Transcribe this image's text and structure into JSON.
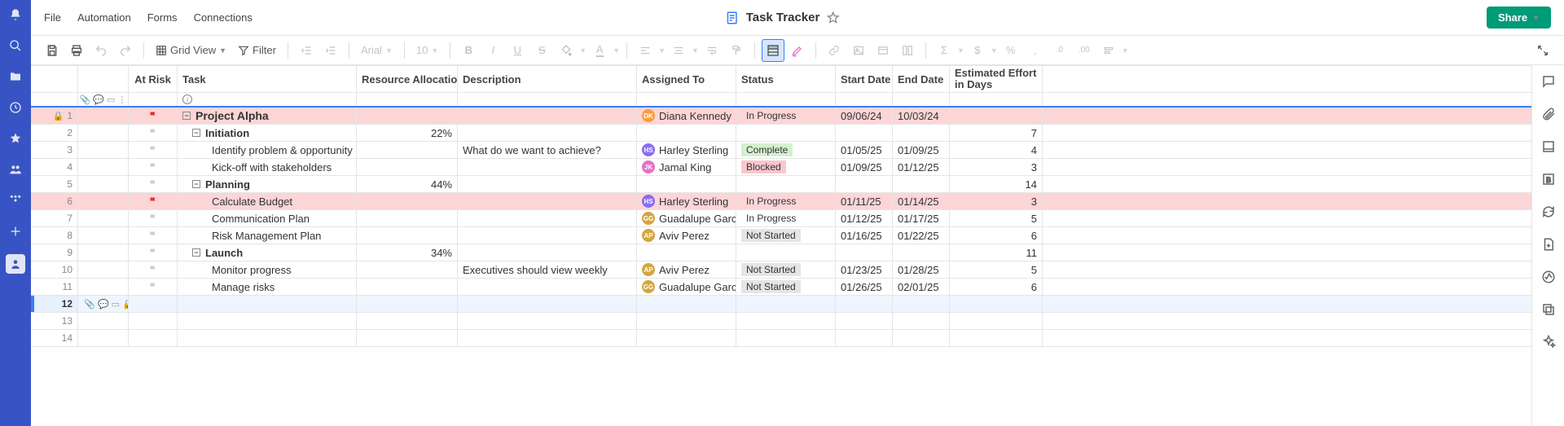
{
  "header": {
    "menu": {
      "file": "File",
      "automation": "Automation",
      "forms": "Forms",
      "connections": "Connections"
    },
    "title": "Task Tracker",
    "share": "Share"
  },
  "toolbar": {
    "view_label": "Grid View",
    "filter_label": "Filter",
    "font_label": "Arial",
    "size_label": "10"
  },
  "columns": {
    "atrisk": "At Risk",
    "task": "Task",
    "resource": "Resource Allocation",
    "description": "Description",
    "assigned": "Assigned To",
    "status": "Status",
    "start": "Start Date",
    "end": "End Date",
    "effort": "Estimated Effort in Days"
  },
  "rows": [
    {
      "n": 1,
      "lock": true,
      "flag": "red",
      "indent": 0,
      "toggle": true,
      "task": "Project Alpha",
      "resource": "",
      "desc": "",
      "assignee": {
        "name": "Diana Kennedy",
        "initials": "DK",
        "cls": "av-dk"
      },
      "status": "In Progress",
      "statusCls": "st-inprogress",
      "start": "09/06/24",
      "end": "10/03/24",
      "effort": "",
      "rowCls": "row-pink"
    },
    {
      "n": 2,
      "flag": "grey",
      "indent": 1,
      "toggle": true,
      "task": "Initiation",
      "resource": "22%",
      "desc": "",
      "assignee": null,
      "status": "",
      "start": "",
      "end": "",
      "effort": "7",
      "rowCls": ""
    },
    {
      "n": 3,
      "flag": "grey",
      "indent": 2,
      "task": "Identify problem & opportunity",
      "resource": "",
      "desc": "What do we want to achieve?",
      "assignee": {
        "name": "Harley Sterling",
        "initials": "HS",
        "cls": "av-hs"
      },
      "status": "Complete",
      "statusCls": "st-complete",
      "start": "01/05/25",
      "end": "01/09/25",
      "effort": "4",
      "rowCls": ""
    },
    {
      "n": 4,
      "flag": "grey",
      "indent": 2,
      "task": "Kick-off with stakeholders",
      "resource": "",
      "desc": "",
      "assignee": {
        "name": "Jamal King",
        "initials": "JK",
        "cls": "av-jk"
      },
      "status": "Blocked",
      "statusCls": "st-blocked",
      "start": "01/09/25",
      "end": "01/12/25",
      "effort": "3",
      "rowCls": ""
    },
    {
      "n": 5,
      "flag": "grey",
      "indent": 1,
      "toggle": true,
      "task": "Planning",
      "resource": "44%",
      "desc": "",
      "assignee": null,
      "status": "",
      "start": "",
      "end": "",
      "effort": "14",
      "rowCls": ""
    },
    {
      "n": 6,
      "flag": "red",
      "indent": 2,
      "task": "Calculate Budget",
      "resource": "",
      "desc": "",
      "assignee": {
        "name": "Harley Sterling",
        "initials": "HS",
        "cls": "av-hs"
      },
      "status": "In Progress",
      "statusCls": "st-inprogress",
      "start": "01/11/25",
      "end": "01/14/25",
      "effort": "3",
      "rowCls": "row-pink-hl"
    },
    {
      "n": 7,
      "flag": "grey",
      "indent": 2,
      "task": "Communication Plan",
      "resource": "",
      "desc": "",
      "assignee": {
        "name": "Guadalupe Garcia",
        "initials": "GG",
        "cls": "av-gg"
      },
      "status": "In Progress",
      "statusCls": "st-inprogress",
      "start": "01/12/25",
      "end": "01/17/25",
      "effort": "5",
      "rowCls": ""
    },
    {
      "n": 8,
      "flag": "grey",
      "indent": 2,
      "task": "Risk Management Plan",
      "resource": "",
      "desc": "",
      "assignee": {
        "name": "Aviv Perez",
        "initials": "AP",
        "cls": "av-ap"
      },
      "status": "Not Started",
      "statusCls": "st-notstarted",
      "start": "01/16/25",
      "end": "01/22/25",
      "effort": "6",
      "rowCls": ""
    },
    {
      "n": 9,
      "flag": "grey",
      "indent": 1,
      "toggle": true,
      "task": "Launch",
      "resource": "34%",
      "desc": "",
      "assignee": null,
      "status": "",
      "start": "",
      "end": "",
      "effort": "11",
      "rowCls": ""
    },
    {
      "n": 10,
      "flag": "grey",
      "indent": 2,
      "task": "Monitor progress",
      "resource": "",
      "desc": "Executives should view weekly",
      "assignee": {
        "name": "Aviv Perez",
        "initials": "AP",
        "cls": "av-ap"
      },
      "status": "Not Started",
      "statusCls": "st-notstarted",
      "start": "01/23/25",
      "end": "01/28/25",
      "effort": "5",
      "rowCls": ""
    },
    {
      "n": 11,
      "flag": "grey",
      "indent": 2,
      "task": "Manage risks",
      "resource": "",
      "desc": "",
      "assignee": {
        "name": "Guadalupe Garcia",
        "initials": "GG",
        "cls": "av-gg"
      },
      "status": "Not Started",
      "statusCls": "st-notstarted",
      "start": "01/26/25",
      "end": "02/01/25",
      "effort": "6",
      "rowCls": ""
    }
  ],
  "empty_rows": [
    12,
    13,
    14
  ],
  "active_row": 12
}
